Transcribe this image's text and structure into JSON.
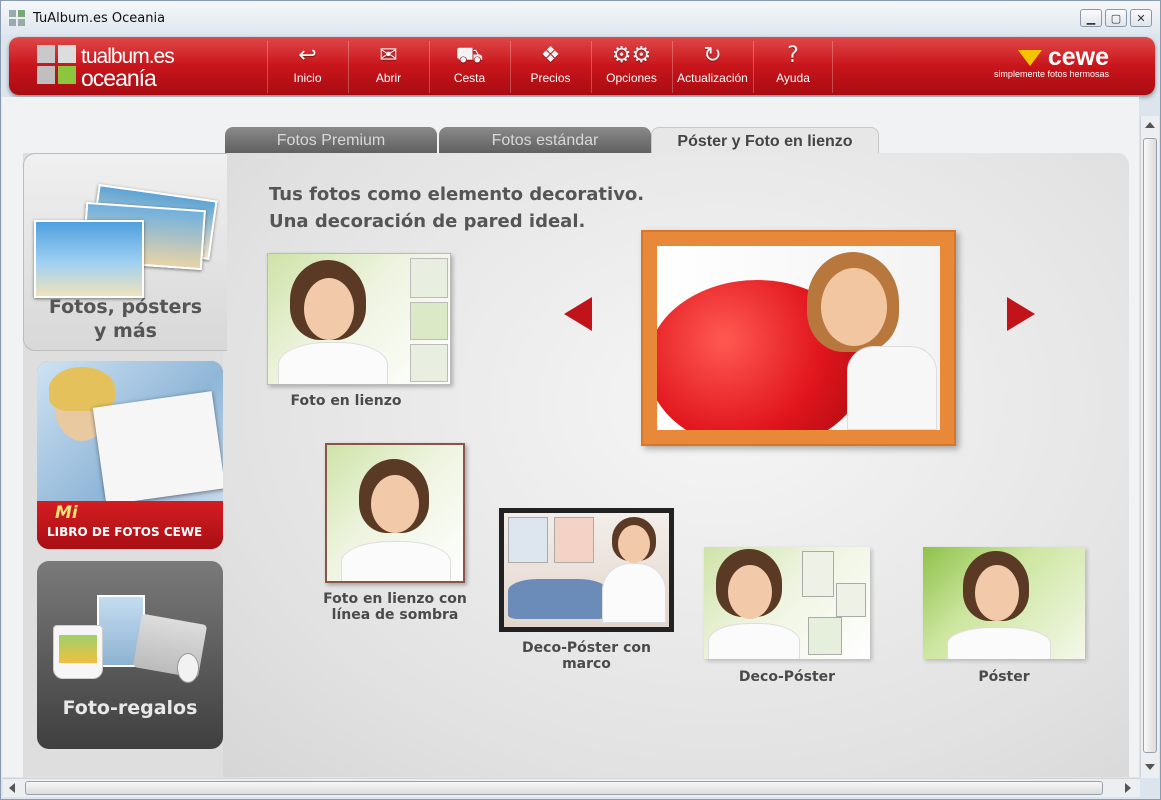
{
  "window": {
    "title": "TuAlbum.es Oceania"
  },
  "logo": {
    "line1": "tualbum.es",
    "line2": "oceanía"
  },
  "toolbar": {
    "buttons": [
      {
        "label": "Inicio",
        "icon": "home-icon"
      },
      {
        "label": "Abrir",
        "icon": "open-icon"
      },
      {
        "label": "Cesta",
        "icon": "cart-icon"
      },
      {
        "label": "Precios",
        "icon": "prices-icon"
      },
      {
        "label": "Opciones",
        "icon": "gears-icon"
      },
      {
        "label": "Actualización",
        "icon": "refresh-icon"
      },
      {
        "label": "Ayuda",
        "icon": "help-icon"
      }
    ]
  },
  "brand": {
    "name": "cewe",
    "slogan": "simplemente fotos hermosas"
  },
  "tabs": [
    {
      "label": "Fotos Premium",
      "active": false
    },
    {
      "label": "Fotos estándar",
      "active": false
    },
    {
      "label": "Póster y Foto en lienzo",
      "active": true
    }
  ],
  "sidebar": {
    "categories": [
      {
        "label1": "Fotos, pósters",
        "label2": "y más",
        "active": true
      },
      {
        "label1": "Mi",
        "label2": "LIBRO DE FOTOS CEWE",
        "active": false
      },
      {
        "label1": "Foto-regalos",
        "active": false
      }
    ]
  },
  "main": {
    "headline1": "Tus fotos como elemento decorativo.",
    "headline2": "Una decoración de pared ideal.",
    "products": [
      {
        "line1": "Foto en lienzo"
      },
      {
        "line1": "Foto en lienzo con",
        "line2": "línea de sombra"
      },
      {
        "line1": "Deco-Póster con marco"
      },
      {
        "line1": "Deco-Póster"
      },
      {
        "line1": "Póster"
      }
    ],
    "colors": {
      "accent": "#c8151b",
      "frame": "#e8893a"
    }
  }
}
